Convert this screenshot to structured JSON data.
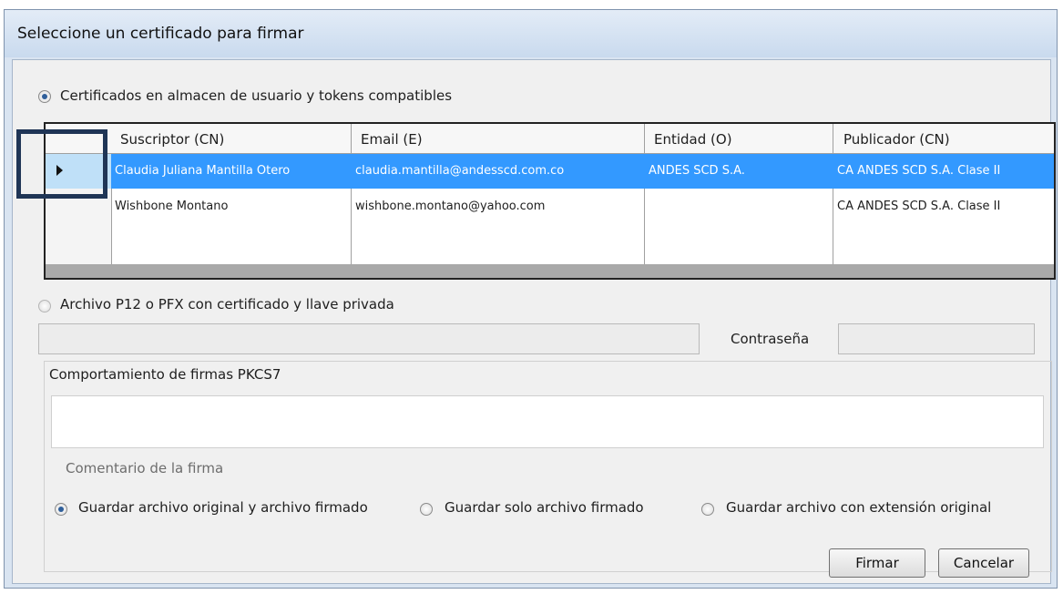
{
  "window": {
    "title": "Seleccione un certificado para firmar"
  },
  "source_options": {
    "store": {
      "label": "Certificados en almacen de usuario y tokens compatibles",
      "checked": true
    },
    "file": {
      "label": "Archivo P12 o PFX con certificado y llave privada",
      "checked": false
    }
  },
  "grid": {
    "columns": [
      "Suscriptor (CN)",
      "Email (E)",
      "Entidad (O)",
      "Publicador (CN)"
    ],
    "rows": [
      [
        "Claudia Juliana Mantilla Otero",
        "claudia.mantilla@andesscd.com.co",
        "ANDES SCD S.A.",
        "CA ANDES SCD S.A. Clase II"
      ],
      [
        "Wishbone Montano",
        "wishbone.montano@yahoo.com",
        "",
        "CA ANDES SCD S.A. Clase II"
      ]
    ],
    "selected_row": 0
  },
  "file_section": {
    "password_label": "Contraseña",
    "file_path": "",
    "password": ""
  },
  "pkcs7": {
    "group_label": "Comportamiento de firmas PKCS7",
    "comment_placeholder": "Comentario de la firma",
    "save_options": [
      {
        "label": "Guardar archivo original y archivo firmado",
        "checked": true
      },
      {
        "label": "Guardar solo archivo firmado",
        "checked": false
      },
      {
        "label": "Guardar archivo con extensión original",
        "checked": false
      }
    ]
  },
  "buttons": {
    "sign": "Firmar",
    "cancel": "Cancelar"
  },
  "colors": {
    "selection": "#3399ff",
    "highlight_box": "#1f3556"
  },
  "icons": {
    "row_pointer": "arrow-right-icon"
  }
}
